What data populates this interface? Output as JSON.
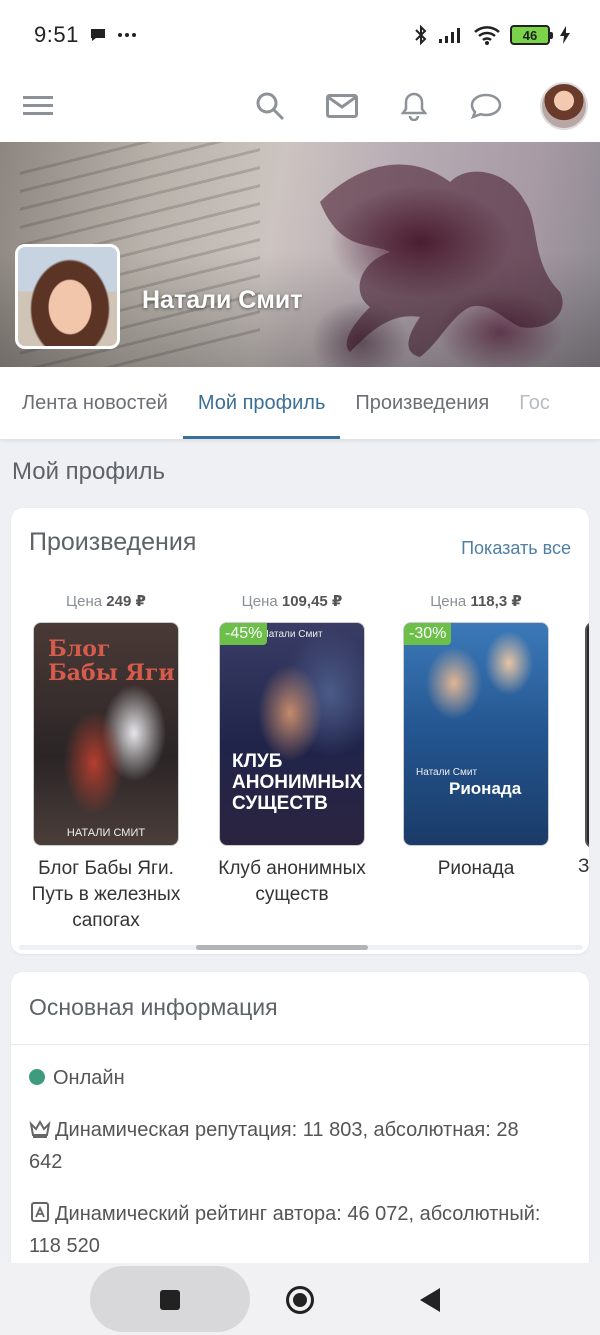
{
  "status_bar": {
    "time": "9:51",
    "battery": "46"
  },
  "header": {
    "icons": [
      "menu-icon",
      "search-icon",
      "mail-icon",
      "bell-icon",
      "chat-icon"
    ]
  },
  "profile": {
    "name": "Натали Смит"
  },
  "tabs": [
    {
      "label": "Лента новостей"
    },
    {
      "label": "Мой профиль"
    },
    {
      "label": "Произведения"
    },
    {
      "label": "Гос"
    }
  ],
  "page_title": "Мой профиль",
  "works": {
    "title": "Произведения",
    "show_all": "Показать все",
    "price_label": "Цена",
    "books": [
      {
        "price": "249 ₽",
        "title": "Блог Бабы Яги. Путь в железных сапогах",
        "discount": "",
        "cover_title": "Блог Бабы Яги",
        "cover_author": "НАТАЛИ СМИТ"
      },
      {
        "price": "109,45 ₽",
        "title": "Клуб анонимных существ",
        "discount": "-45%",
        "cover_title": "КЛУБ АНОНИМНЫХ СУЩЕСТВ",
        "cover_author": "Натали Смит"
      },
      {
        "price": "118,3 ₽",
        "title": "Рионада",
        "discount": "-30%",
        "cover_title": "Рионада",
        "cover_author": "Натали Смит"
      }
    ],
    "next_book_peek": "З"
  },
  "info": {
    "title": "Основная информация",
    "online": "Онлайн",
    "reputation": "Динамическая репутация: 11 803, абсолютная: 28 642",
    "rating": "Динамический рейтинг автора: 46 072, абсолютный: 118 520"
  },
  "colors": {
    "accent": "#3a6f97",
    "link": "#4f7fa5",
    "discount": "#6cc04a",
    "online": "#3e9c7e"
  }
}
